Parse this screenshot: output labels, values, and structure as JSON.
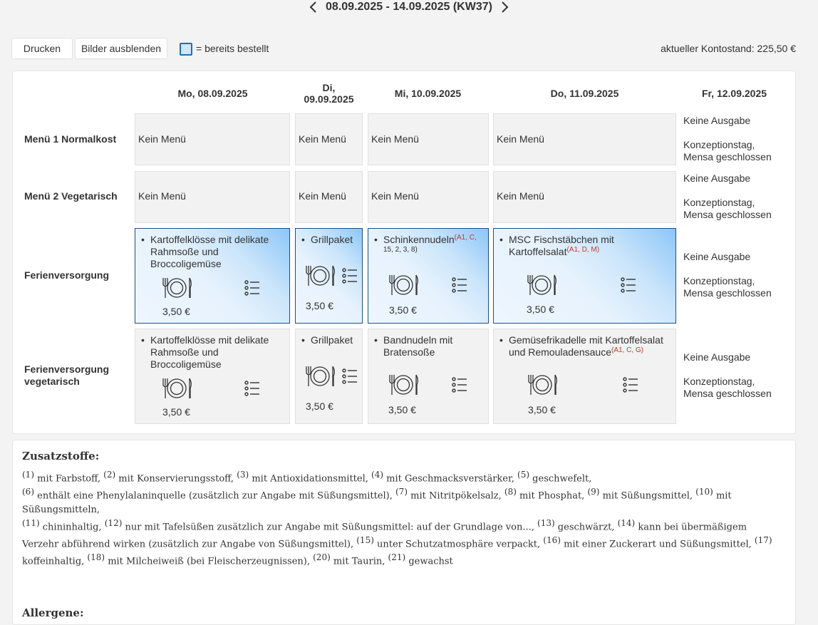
{
  "week": {
    "label": "08.09.2025 - 14.09.2025 (KW37)"
  },
  "toolbar": {
    "print_label": "Drucken",
    "hide_images_label": "Bilder ausblenden"
  },
  "legend": {
    "text": "= bereits bestellt"
  },
  "balance": {
    "text": "aktueller Kontostand: 225,50 €"
  },
  "days": [
    {
      "label": "Mo, 08.09.2025"
    },
    {
      "line1": "Di,",
      "line2": "09.09.2025"
    },
    {
      "label": "Mi, 10.09.2025"
    },
    {
      "label": "Do, 11.09.2025"
    },
    {
      "label": "Fr, 12.09.2025"
    }
  ],
  "rows": [
    {
      "label": "Menü 1 Normalkost"
    },
    {
      "label": "Menü 2 Vegetarisch"
    },
    {
      "label": "Ferienversorgung"
    },
    {
      "line1": "Ferienversorgung",
      "line2": "vegetarisch"
    }
  ],
  "no_menu": "Kein Menü",
  "friday": {
    "line1": "Keine Ausgabe",
    "line2": "Konzeptionstag,",
    "line3": "Mensa geschlossen"
  },
  "ferien": {
    "mo": {
      "l1": "Kartoffelklösse mit delikate",
      "l2": "Rahmsoße und",
      "l3": "Broccoligemüse",
      "price": "3,50 €"
    },
    "di": {
      "l1": "Grillpaket",
      "price": "3,50 €"
    },
    "mi": {
      "l1": "Schinkennudeln",
      "alg1": "(A1, C,",
      "alg2": "15, 2, 3, 8)",
      "price": "3,50 €"
    },
    "do": {
      "l1": "MSC Fischstäbchen mit",
      "l2": "Kartoffelsalat",
      "alg": "(A1, D, M)",
      "price": "3,50 €"
    }
  },
  "ferien_veg": {
    "mo": {
      "l1": "Kartoffelklösse mit delikate",
      "l2": "Rahmsoße und",
      "l3": "Broccoligemüse",
      "price": "3,50 €"
    },
    "di": {
      "l1": "Grillpaket",
      "price": "3,50 €"
    },
    "mi": {
      "l1": "Bandnudeln mit",
      "l2": "Bratensoße",
      "price": "3,50 €"
    },
    "do": {
      "l1": "Gemüsefrikadelle mit Kartoffelsalat",
      "l2": "und Remouladensauce",
      "alg": "(A1, C, G)",
      "price": "3,50 €"
    }
  },
  "additives": {
    "title": "Zusatzstoffe:",
    "items": [
      {
        "n": "(1)",
        "t": " mit Farbstoff, "
      },
      {
        "n": "(2)",
        "t": " mit Konservierungsstoff, "
      },
      {
        "n": "(3)",
        "t": " mit Antioxidationsmittel, "
      },
      {
        "n": "(4)",
        "t": " mit Geschmacksverstärker, "
      },
      {
        "n": "(5)",
        "t": " geschwefelt, "
      },
      {
        "n": "(6)",
        "t": " enthält eine Phenylalaninquelle (zusätzlich zur Angabe mit Süßungsmittel), "
      },
      {
        "n": "(7)",
        "t": " mit Nitritpökelsalz, "
      },
      {
        "n": "(8)",
        "t": " mit Phosphat, "
      },
      {
        "n": "(9)",
        "t": " mit Süßungsmittel, "
      },
      {
        "n": "(10)",
        "t": " mit Süßungsmitteln, "
      },
      {
        "n": "(11)",
        "t": " chininhaltig, "
      },
      {
        "n": "(12)",
        "t": " nur mit Tafelsüßen zusätzlich zur Angabe mit Süßungsmittel: auf der Grundlage von..., "
      },
      {
        "n": "(13)",
        "t": " geschwärzt, "
      },
      {
        "n": "(14)",
        "t": " kann bei übermäßigem Verzehr abführend wirken (zusätzlich zur Angabe von Süßungsmittel), "
      },
      {
        "n": "(15)",
        "t": " unter Schutzatmosphäre verpackt, "
      },
      {
        "n": "(16)",
        "t": " mit einer Zuckerart und Süßungsmittel, "
      },
      {
        "n": "(17)",
        "t": " koffeinhaltig, "
      },
      {
        "n": "(18)",
        "t": " mit Milcheiweiß (bei Fleischerzeugnissen), "
      },
      {
        "n": "(20)",
        "t": " mit Taurin, "
      },
      {
        "n": "(21)",
        "t": " gewachst"
      }
    ]
  },
  "allergens": {
    "title": "Allergene:"
  }
}
